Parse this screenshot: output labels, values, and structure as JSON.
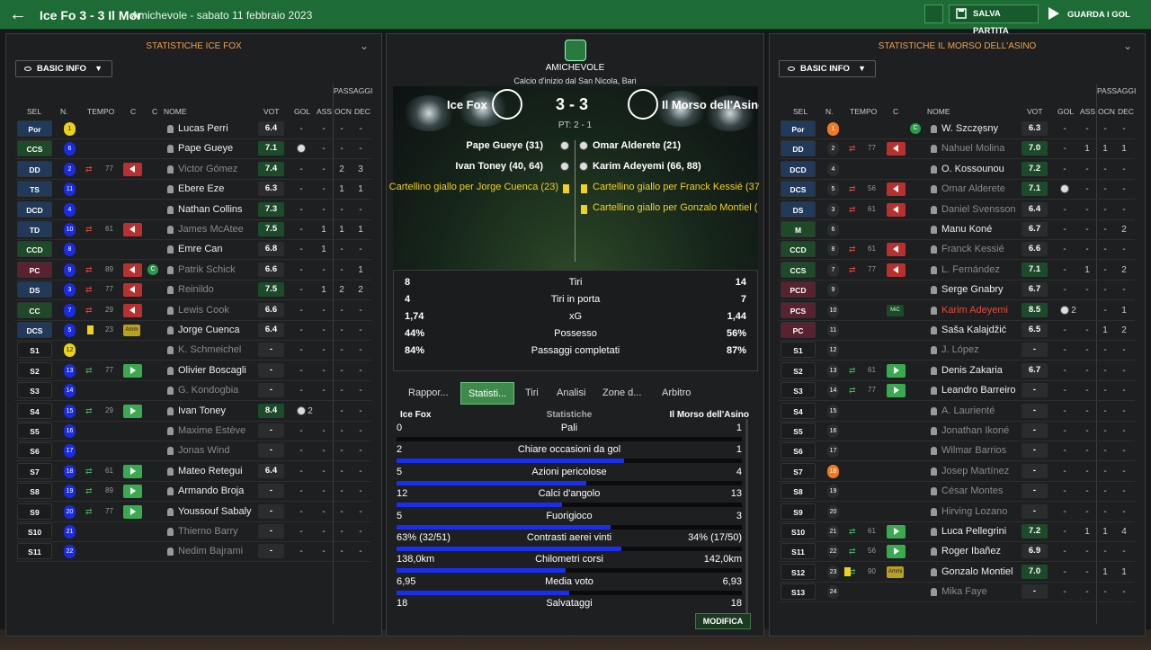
{
  "topbar": {
    "title": "Ice Fo 3 - 3 Il Mor",
    "subtitle": "Amichevole - sabato 11 febbraio 2023",
    "save_label": "SALVA PARTITA",
    "goals_label": "GUARDA I GOL"
  },
  "left": {
    "header": "STATISTICHE ICE FOX",
    "basic": "BASIC INFO",
    "cols": {
      "sel": "SEL",
      "n": "N.",
      "tempo": "TEMPO",
      "c1": "C",
      "c2": "C",
      "nome": "NOME",
      "vot": "VOT",
      "gol": "GOL",
      "ass": "ASS",
      "passaggi": "PASSAGGI",
      "ocn": "OCN",
      "dec": "DEC"
    },
    "rows": [
      {
        "pos": "Por",
        "n": "1",
        "ncol": "#e8d21a",
        "name": "Lucas Perri",
        "vot": "6.4",
        "gol": "-",
        "ass": "-",
        "ocn": "-",
        "dec": "-"
      },
      {
        "pos": "CCS",
        "n": "6",
        "ncol": "#1a2be0",
        "name": "Pape Gueye",
        "vot": "7.1",
        "vg": true,
        "ball": true,
        "ass": "-",
        "ocn": "-",
        "dec": "-"
      },
      {
        "pos": "DD",
        "n": "2",
        "ncol": "#1a2be0",
        "tempo": "77",
        "out": true,
        "flag": "out",
        "name": "Victor Gómez",
        "dim": true,
        "vot": "7.4",
        "vg": true,
        "gol": "-",
        "ass": "-",
        "ocn": "2",
        "dec": "3"
      },
      {
        "pos": "TS",
        "n": "11",
        "ncol": "#1a2be0",
        "name": "Ebere Eze",
        "vot": "6.3",
        "gol": "-",
        "ass": "-",
        "ocn": "1",
        "dec": "1"
      },
      {
        "pos": "DCD",
        "n": "4",
        "ncol": "#1a2be0",
        "name": "Nathan Collins",
        "vot": "7.3",
        "vg": true,
        "gol": "-",
        "ass": "-",
        "ocn": "-",
        "dec": "-"
      },
      {
        "pos": "TD",
        "n": "10",
        "ncol": "#1a2be0",
        "tempo": "61",
        "out": true,
        "flag": "out",
        "name": "James McAtee",
        "dim": true,
        "vot": "7.5",
        "vg": true,
        "gol": "-",
        "ass": "1",
        "ocn": "1",
        "dec": "1"
      },
      {
        "pos": "CCD",
        "n": "8",
        "ncol": "#1a2be0",
        "name": "Emre Can",
        "vot": "6.8",
        "gol": "-",
        "ass": "1",
        "ocn": "-",
        "dec": "-"
      },
      {
        "pos": "PC",
        "n": "9",
        "ncol": "#1a2be0",
        "tempo": "89",
        "out": true,
        "flag": "out",
        "captain": true,
        "name": "Patrik Schick",
        "dim": true,
        "vot": "6.6",
        "gol": "-",
        "ass": "-",
        "ocn": "-",
        "dec": "1"
      },
      {
        "pos": "DS",
        "n": "3",
        "ncol": "#1a2be0",
        "tempo": "77",
        "out": true,
        "flag": "out",
        "name": "Reinildo",
        "dim": true,
        "vot": "7.5",
        "vg": true,
        "gol": "-",
        "ass": "1",
        "ocn": "2",
        "dec": "2"
      },
      {
        "pos": "CC",
        "n": "7",
        "ncol": "#1a2be0",
        "tempo": "29",
        "out": true,
        "flag": "out",
        "name": "Lewis Cook",
        "dim": true,
        "vot": "6.6",
        "gol": "-",
        "ass": "-",
        "ocn": "-",
        "dec": "-"
      },
      {
        "pos": "DCS",
        "n": "5",
        "ncol": "#1a2be0",
        "tempo": "23",
        "ycard": true,
        "arm": "Amm",
        "name": "Jorge Cuenca",
        "vot": "6.4",
        "gol": "-",
        "ass": "-",
        "ocn": "-",
        "dec": "-"
      },
      {
        "pos": "S1",
        "n": "12",
        "ncol": "#e8d21a",
        "name": "K. Schmeichel",
        "dim": true,
        "vot": "-",
        "gol": "-",
        "ass": "-",
        "ocn": "-",
        "dec": "-"
      },
      {
        "pos": "S2",
        "n": "13",
        "ncol": "#1a2be0",
        "tempo": "77",
        "inn": true,
        "flag": "in",
        "name": "Olivier Boscagli",
        "vot": "-",
        "gol": "-",
        "ass": "-",
        "ocn": "-",
        "dec": "-"
      },
      {
        "pos": "S3",
        "n": "14",
        "ncol": "#1a2be0",
        "name": "G. Kondogbia",
        "dim": true,
        "vot": "-",
        "gol": "-",
        "ass": "-",
        "ocn": "-",
        "dec": "-"
      },
      {
        "pos": "S4",
        "n": "15",
        "ncol": "#1a2be0",
        "tempo": "29",
        "inn": true,
        "flag": "in",
        "name": "Ivan Toney",
        "vot": "8.4",
        "vg": true,
        "ball": true,
        "balls": "2",
        "ocn": "-",
        "dec": "-"
      },
      {
        "pos": "S5",
        "n": "16",
        "ncol": "#1a2be0",
        "name": "Maxime Estève",
        "dim": true,
        "vot": "-",
        "gol": "-",
        "ass": "-",
        "ocn": "-",
        "dec": "-"
      },
      {
        "pos": "S6",
        "n": "17",
        "ncol": "#1a2be0",
        "name": "Jonas Wind",
        "dim": true,
        "vot": "-",
        "gol": "-",
        "ass": "-",
        "ocn": "-",
        "dec": "-"
      },
      {
        "pos": "S7",
        "n": "18",
        "ncol": "#1a2be0",
        "tempo": "61",
        "inn": true,
        "flag": "in",
        "name": "Mateo Retegui",
        "vot": "6.4",
        "gol": "-",
        "ass": "-",
        "ocn": "-",
        "dec": "-"
      },
      {
        "pos": "S8",
        "n": "19",
        "ncol": "#1a2be0",
        "tempo": "89",
        "inn": true,
        "flag": "in",
        "name": "Armando Broja",
        "vot": "-",
        "gol": "-",
        "ass": "-",
        "ocn": "-",
        "dec": "-"
      },
      {
        "pos": "S9",
        "n": "20",
        "ncol": "#1a2be0",
        "tempo": "77",
        "inn": true,
        "flag": "in",
        "name": "Youssouf Sabaly",
        "vot": "-",
        "gol": "-",
        "ass": "-",
        "ocn": "-",
        "dec": "-"
      },
      {
        "pos": "S10",
        "n": "21",
        "ncol": "#1a2be0",
        "name": "Thierno Barry",
        "dim": true,
        "vot": "-",
        "gol": "-",
        "ass": "-",
        "ocn": "-",
        "dec": "-"
      },
      {
        "pos": "S11",
        "n": "22",
        "ncol": "#1a2be0",
        "name": "Nedim Bajrami",
        "dim": true,
        "vot": "-",
        "gol": "-",
        "ass": "-",
        "ocn": "-",
        "dec": "-"
      }
    ]
  },
  "right": {
    "header": "STATISTICHE IL MORSO DELL'ASINO",
    "basic": "BASIC INFO",
    "cols": {
      "sel": "SEL",
      "n": "N.",
      "tempo": "TEMPO",
      "c1": "C",
      "nome": "NOME",
      "vot": "VOT",
      "gol": "GOL",
      "ass": "ASS",
      "passaggi": "PASSAGGI",
      "ocn": "OCN",
      "dec": "DEC"
    },
    "rows": [
      {
        "pos": "Por",
        "n": "1",
        "ncol": "#f07a20",
        "captain": true,
        "name": "W. Szczęsny",
        "vot": "6.3",
        "gol": "-",
        "ass": "-",
        "ocn": "-",
        "dec": "-"
      },
      {
        "pos": "DD",
        "n": "2",
        "ncol": "#2a2c2e",
        "tempo": "77",
        "out": true,
        "flag": "out",
        "name": "Nahuel Molina",
        "dim": true,
        "vot": "7.0",
        "vg": true,
        "gol": "-",
        "ass": "1",
        "ocn": "1",
        "dec": "1"
      },
      {
        "pos": "DCD",
        "n": "4",
        "ncol": "#2a2c2e",
        "name": "O. Kossounou",
        "vot": "7.2",
        "vg": true,
        "gol": "-",
        "ass": "-",
        "ocn": "-",
        "dec": "-"
      },
      {
        "pos": "DCS",
        "n": "5",
        "ncol": "#2a2c2e",
        "tempo": "56",
        "out": true,
        "flag": "out",
        "name": "Omar Alderete",
        "dim": true,
        "vot": "7.1",
        "vg": true,
        "ball": true,
        "ass": "-",
        "ocn": "-",
        "dec": "-"
      },
      {
        "pos": "DS",
        "n": "3",
        "ncol": "#2a2c2e",
        "tempo": "61",
        "out": true,
        "flag": "out",
        "name": "Daniel Svensson",
        "dim": true,
        "vot": "6.4",
        "gol": "-",
        "ass": "-",
        "ocn": "-",
        "dec": "-"
      },
      {
        "pos": "M",
        "n": "6",
        "ncol": "#2a2c2e",
        "name": "Manu Koné",
        "vot": "6.7",
        "gol": "-",
        "ass": "-",
        "ocn": "-",
        "dec": "2"
      },
      {
        "pos": "CCD",
        "n": "8",
        "ncol": "#2a2c2e",
        "tempo": "61",
        "out": true,
        "flag": "out",
        "name": "Franck Kessié",
        "dim": true,
        "vot": "6.6",
        "gol": "-",
        "ass": "-",
        "ocn": "-",
        "dec": "-"
      },
      {
        "pos": "CCS",
        "n": "7",
        "ncol": "#2a2c2e",
        "tempo": "77",
        "out": true,
        "flag": "out",
        "name": "L. Fernández",
        "dim": true,
        "vot": "7.1",
        "vg": true,
        "gol": "-",
        "ass": "1",
        "ocn": "-",
        "dec": "2"
      },
      {
        "pos": "PCD",
        "n": "9",
        "ncol": "#2a2c2e",
        "name": "Serge Gnabry",
        "vot": "6.7",
        "gol": "-",
        "ass": "-",
        "ocn": "-",
        "dec": "-"
      },
      {
        "pos": "PCS",
        "n": "10",
        "ncol": "#2a2c2e",
        "arm": "MiC",
        "name": "Karim Adeyemi",
        "red": true,
        "vot": "8.5",
        "vg": true,
        "ball": true,
        "balls": "2",
        "ocn": "-",
        "dec": "1"
      },
      {
        "pos": "PC",
        "n": "11",
        "ncol": "#2a2c2e",
        "name": "Saša Kalajdžić",
        "vot": "6.5",
        "gol": "-",
        "ass": "-",
        "ocn": "1",
        "dec": "2"
      },
      {
        "pos": "S1",
        "n": "12",
        "ncol": "#2a2c2e",
        "name": "J. López",
        "dim": true,
        "vot": "-",
        "gol": "-",
        "ass": "-",
        "ocn": "-",
        "dec": "-"
      },
      {
        "pos": "S2",
        "n": "13",
        "ncol": "#2a2c2e",
        "tempo": "61",
        "inn": true,
        "flag": "in",
        "name": "Denis Zakaria",
        "vot": "6.7",
        "gol": "-",
        "ass": "-",
        "ocn": "-",
        "dec": "-"
      },
      {
        "pos": "S3",
        "n": "14",
        "ncol": "#2a2c2e",
        "tempo": "77",
        "inn": true,
        "flag": "in",
        "name": "Leandro Barreiro",
        "vot": "-",
        "gol": "-",
        "ass": "-",
        "ocn": "-",
        "dec": "-"
      },
      {
        "pos": "S4",
        "n": "15",
        "ncol": "#2a2c2e",
        "name": "A. Laurienté",
        "dim": true,
        "vot": "-",
        "gol": "-",
        "ass": "-",
        "ocn": "-",
        "dec": "-"
      },
      {
        "pos": "S5",
        "n": "16",
        "ncol": "#2a2c2e",
        "name": "Jonathan Ikoné",
        "dim": true,
        "vot": "-",
        "gol": "-",
        "ass": "-",
        "ocn": "-",
        "dec": "-"
      },
      {
        "pos": "S6",
        "n": "17",
        "ncol": "#2a2c2e",
        "name": "Wilmar Barrios",
        "dim": true,
        "vot": "-",
        "gol": "-",
        "ass": "-",
        "ocn": "-",
        "dec": "-"
      },
      {
        "pos": "S7",
        "n": "18",
        "ncol": "#f07a20",
        "name": "Josep Martínez",
        "dim": true,
        "vot": "-",
        "gol": "-",
        "ass": "-",
        "ocn": "-",
        "dec": "-"
      },
      {
        "pos": "S8",
        "n": "19",
        "ncol": "#2a2c2e",
        "name": "César Montes",
        "dim": true,
        "vot": "-",
        "gol": "-",
        "ass": "-",
        "ocn": "-",
        "dec": "-"
      },
      {
        "pos": "S9",
        "n": "20",
        "ncol": "#2a2c2e",
        "name": "Hirving Lozano",
        "dim": true,
        "vot": "-",
        "gol": "-",
        "ass": "-",
        "ocn": "-",
        "dec": "-"
      },
      {
        "pos": "S10",
        "n": "21",
        "ncol": "#2a2c2e",
        "tempo": "61",
        "inn": true,
        "flag": "in",
        "name": "Luca Pellegrini",
        "vot": "7.2",
        "vg": true,
        "gol": "-",
        "ass": "1",
        "ocn": "1",
        "dec": "4"
      },
      {
        "pos": "S11",
        "n": "22",
        "ncol": "#2a2c2e",
        "tempo": "56",
        "inn": true,
        "flag": "in",
        "name": "Roger Ibañez",
        "vot": "6.9",
        "gol": "-",
        "ass": "-",
        "ocn": "-",
        "dec": "-"
      },
      {
        "pos": "S12",
        "n": "23",
        "ncol": "#2a2c2e",
        "tempo": "90",
        "ycard": true,
        "arm": "Ammi",
        "inn": true,
        "name": "Gonzalo Montiel",
        "vot": "7.0",
        "vg": true,
        "gol": "-",
        "ass": "-",
        "ocn": "1",
        "dec": "1"
      },
      {
        "pos": "S13",
        "n": "24",
        "ncol": "#2a2c2e",
        "name": "Mika Faye",
        "dim": true,
        "vot": "-",
        "gol": "-",
        "ass": "-",
        "ocn": "-",
        "dec": "-"
      }
    ]
  },
  "match": {
    "competition": "AMICHEVOLE",
    "venue": "Calcio d'inizio dal San Nicola, Bari",
    "home": "Ice Fox",
    "away": "Il Morso dell'Asino",
    "score": "3 - 3",
    "ht": "PT: 2 - 1",
    "home_events": [
      "Pape Gueye (31)",
      "Ivan Toney (40, 64)",
      "Cartellino giallo per Jorge Cuenca (23)"
    ],
    "away_events": [
      "Omar Alderete (21)",
      "Karim Adeyemi (66, 88)",
      "Cartellino giallo per Franck Kessié (37)",
      "Cartellino giallo per Gonzalo Montiel ("
    ]
  },
  "summary": [
    {
      "l": "8",
      "label": "Tiri",
      "r": "14"
    },
    {
      "l": "4",
      "label": "Tiri in porta",
      "r": "7"
    },
    {
      "l": "1,74",
      "label": "xG",
      "r": "1,44"
    },
    {
      "l": "44%",
      "label": "Possesso",
      "r": "56%"
    },
    {
      "l": "84%",
      "label": "Passaggi completati",
      "r": "87%"
    }
  ],
  "tabs": [
    "Rappor...",
    "Statisti...",
    "Tiri",
    "Analisi",
    "Zone d...",
    "Arbitro"
  ],
  "detail": {
    "home": "Ice Fox",
    "mid": "Statistiche",
    "away": "Il Morso dell'Asino",
    "rows": [
      {
        "l": "0",
        "label": "Pali",
        "r": "1",
        "frac": 0
      },
      {
        "l": "2",
        "label": "Chiare occasioni da gol",
        "r": "1",
        "frac": 0.66
      },
      {
        "l": "5",
        "label": "Azioni pericolose",
        "r": "4",
        "frac": 0.55
      },
      {
        "l": "12",
        "label": "Calci d'angolo",
        "r": "13",
        "frac": 0.48
      },
      {
        "l": "5",
        "label": "Fuorigioco",
        "r": "3",
        "frac": 0.62
      },
      {
        "l": "63% (32/51)",
        "label": "Contrasti aerei vinti",
        "r": "34% (17/50)",
        "frac": 0.65
      },
      {
        "l": "138,0km",
        "label": "Chilometri corsi",
        "r": "142,0km",
        "frac": 0.49
      },
      {
        "l": "6,95",
        "label": "Media voto",
        "r": "6,93",
        "frac": 0.5
      },
      {
        "l": "18",
        "label": "Salvataggi",
        "r": "18",
        "frac": 0.5
      }
    ],
    "modifica": "MODIFICA"
  },
  "colors": {
    "topbar": "#1d6b35",
    "rating_good": "#1d4a2a",
    "bar": "#1a2ef0",
    "header_orange": "#f0a04b"
  }
}
